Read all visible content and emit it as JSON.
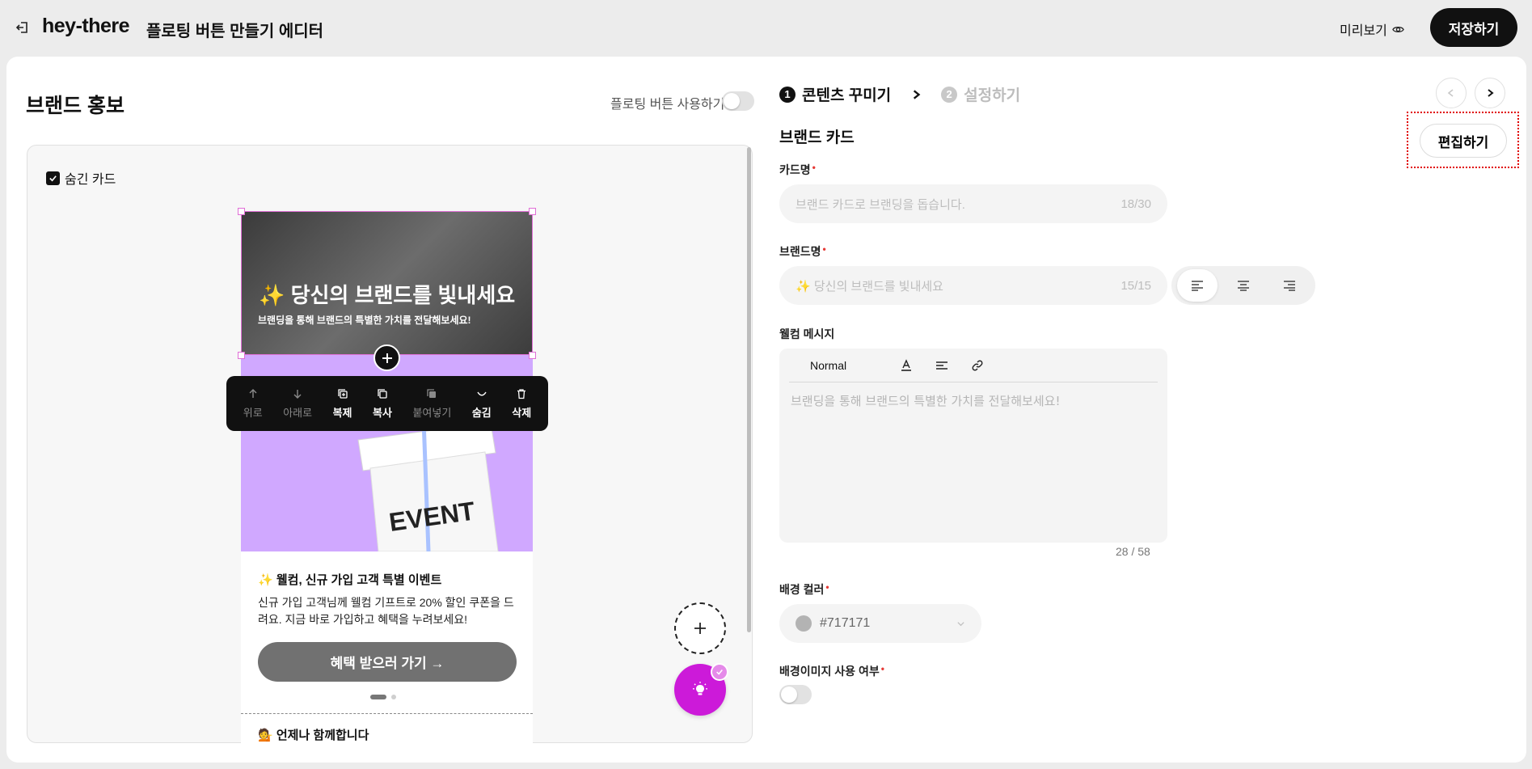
{
  "header": {
    "logo": "hey-there",
    "editor_title": "플로팅 버튼 만들기 에디터",
    "preview_label": "미리보기",
    "save_label": "저장하기"
  },
  "left": {
    "section_title": "브랜드 홍보",
    "floating_toggle_label": "플로팅 버튼 사용하기",
    "floating_toggle_on": false,
    "hidden_card_label": "숨긴 카드",
    "hidden_card_checked": true
  },
  "phone": {
    "banner_title": "✨ 당신의 브랜드를 빛내세요",
    "banner_sub": "브랜딩을 통해 브랜드의 특별한 가치를 전달해보세요!",
    "event_label": "EVENT",
    "product_title": "✨ 웰컴, 신규 가입 고객 특별 이벤트",
    "product_desc": "신규 가입 고객님께 웰컴 기프트로 20% 할인 쿠폰을 드려요. 지금 바로 가입하고 혜택을 누려보세요!",
    "benefit_button": "혜택 받으러 가기 →",
    "together_title": "💁 언제나 함께합니다"
  },
  "toolbar": {
    "items": [
      {
        "label": "위로",
        "icon": "arrow-up-icon",
        "enabled": false
      },
      {
        "label": "아래로",
        "icon": "arrow-down-icon",
        "enabled": false
      },
      {
        "label": "복제",
        "icon": "duplicate-icon",
        "enabled": true
      },
      {
        "label": "복사",
        "icon": "copy-icon",
        "enabled": true
      },
      {
        "label": "붙여넣기",
        "icon": "paste-icon",
        "enabled": false
      },
      {
        "label": "숨김",
        "icon": "hide-icon",
        "enabled": true
      },
      {
        "label": "삭제",
        "icon": "trash-icon",
        "enabled": true
      }
    ]
  },
  "steps": {
    "step1_num": "1",
    "step1_label": "콘텐츠 꾸미기",
    "step2_num": "2",
    "step2_label": "설정하기"
  },
  "form": {
    "card_heading": "브랜드 카드",
    "edit_button": "편집하기",
    "card_name_label": "카드명",
    "card_name_placeholder": "브랜드 카드로 브랜딩을 돕습니다.",
    "card_name_count": "18/30",
    "brand_name_label": "브랜드명",
    "brand_name_placeholder": "✨ 당신의 브랜드를 빛내세요",
    "brand_name_count": "15/15",
    "welcome_label": "웰컴 메시지",
    "editor_format": "Normal",
    "welcome_placeholder": "브랜딩을 통해 브랜드의 특별한 가치를 전달해보세요!",
    "welcome_count": "28 / 58",
    "bg_color_label": "배경 컬러",
    "bg_color_value": "#717171",
    "bg_image_label": "배경이미지 사용 여부",
    "bg_image_on": false
  },
  "colors": {
    "accent": "#cc1ad9",
    "event_bg": "#d0a8ff",
    "selection": "#e06fd6",
    "bg_swatch": "#b3b3b3"
  }
}
